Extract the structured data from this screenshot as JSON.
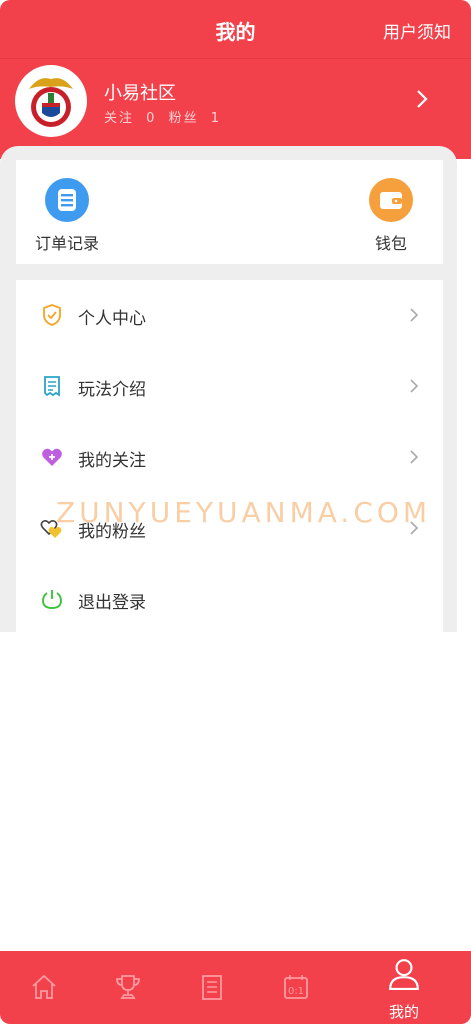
{
  "header": {
    "title": "我的",
    "notice": "用户须知"
  },
  "profile": {
    "username": "小易社区",
    "follow_label": "关注",
    "follow_count": "0",
    "fans_label": "粉丝",
    "fans_count": "1"
  },
  "quick_actions": [
    {
      "label": "订单记录",
      "icon": "order-list-icon",
      "color": "#3f9bf0"
    },
    {
      "label": "钱包",
      "icon": "wallet-icon",
      "color": "#f5a03c"
    }
  ],
  "menu": [
    {
      "label": "个人中心",
      "icon": "shield-check-icon",
      "color": "#f5a623"
    },
    {
      "label": "玩法介绍",
      "icon": "receipt-icon",
      "color": "#2ba4c8"
    },
    {
      "label": "我的关注",
      "icon": "heart-plus-icon",
      "color": "#b453d6"
    },
    {
      "label": "我的粉丝",
      "icon": "hearts-icon",
      "color": "#e8b21a"
    },
    {
      "label": "退出登录",
      "icon": "power-icon",
      "color": "#3cc33c"
    }
  ],
  "watermark": "ZUNYUEYUANMA.COM",
  "tabbar": [
    {
      "label": "",
      "icon": "home-icon"
    },
    {
      "label": "",
      "icon": "trophy-icon"
    },
    {
      "label": "",
      "icon": "clipboard-icon"
    },
    {
      "label": "",
      "icon": "calendar-score-icon"
    },
    {
      "label": "我的",
      "icon": "user-icon"
    }
  ],
  "colors": {
    "primary": "#f2414b",
    "panel": "#eeeeee"
  }
}
